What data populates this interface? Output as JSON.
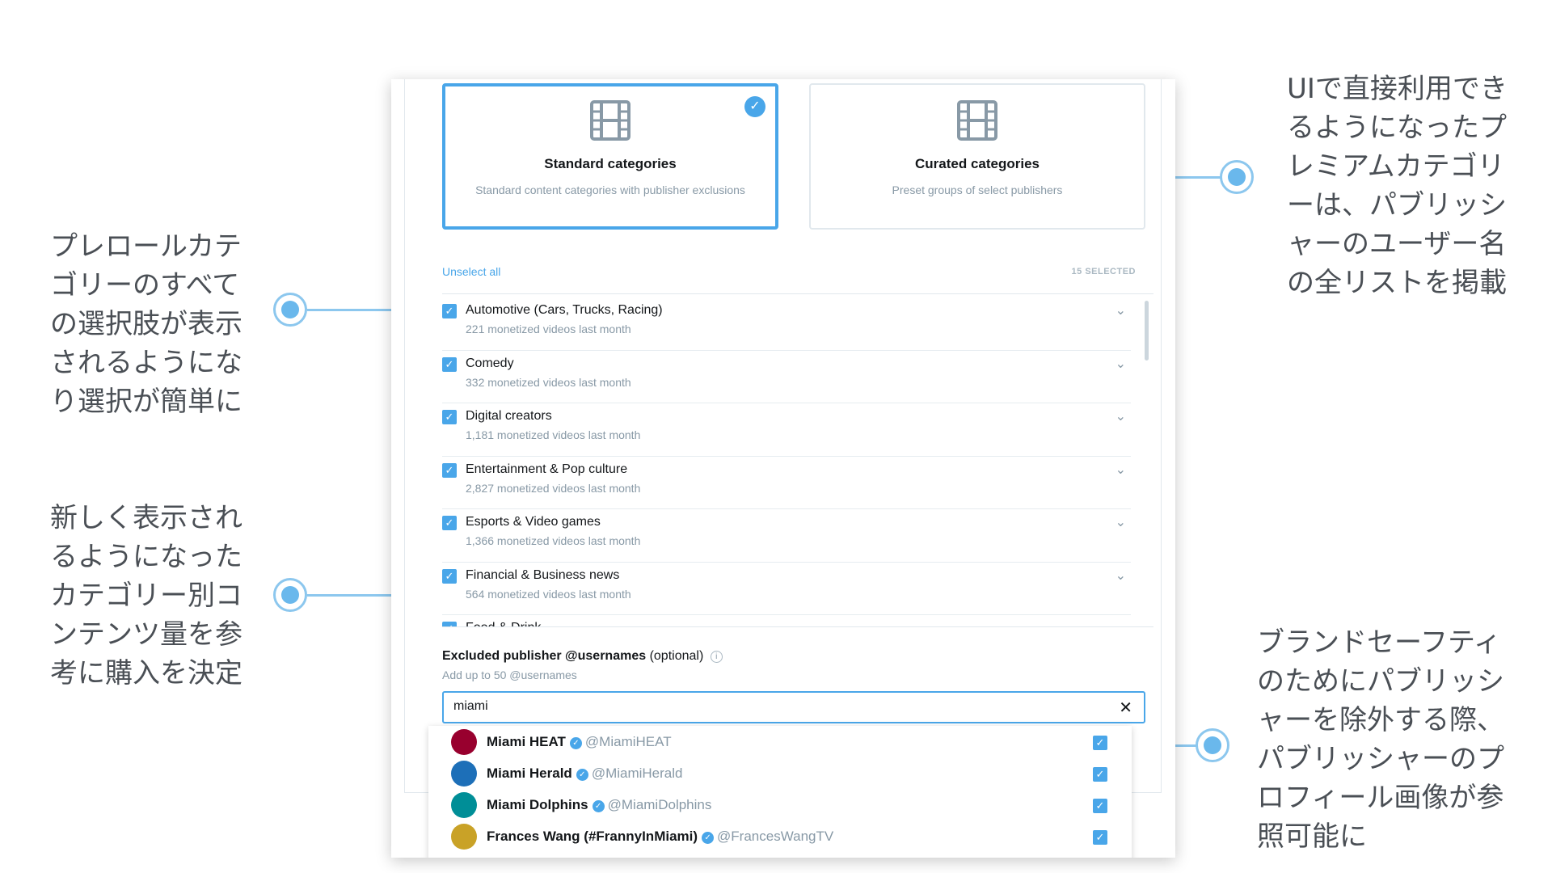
{
  "annotations": {
    "categories_note": "プレロールカテゴリーのすべての選択肢が表示されるようになり選択が簡単に",
    "volume_note": "新しく表示されるようになったカテゴリー別コンテンツ量を参考に購入を決定",
    "premium_note": "UIで直接利用できるようになったプレミアムカテゴリーは、パブリッシャーのユーザー名の全リストを掲載",
    "brand_safety_note": "ブランドセーフティのためにパブリッシャーを除外する際、パブリッシャーのプロフィール画像が参照可能に"
  },
  "category_types": [
    {
      "title": "Standard categories",
      "description": "Standard content categories with publisher exclusions",
      "selected": true,
      "icon": "film-icon"
    },
    {
      "title": "Curated categories",
      "description": "Preset groups of select publishers",
      "selected": false,
      "icon": "film-icon"
    }
  ],
  "toolbar": {
    "unselect_all": "Unselect all",
    "selected_count": "15 SELECTED"
  },
  "categories": [
    {
      "name": "Automotive (Cars, Trucks, Racing)",
      "count": "221 monetized videos last month",
      "checked": true
    },
    {
      "name": "Comedy",
      "count": "332 monetized videos last month",
      "checked": true
    },
    {
      "name": "Digital creators",
      "count": "1,181 monetized videos last month",
      "checked": true
    },
    {
      "name": "Entertainment & Pop culture",
      "count": "2,827 monetized videos last month",
      "checked": true
    },
    {
      "name": "Esports & Video games",
      "count": "1,366 monetized videos last month",
      "checked": true
    },
    {
      "name": "Financial & Business news",
      "count": "564 monetized videos last month",
      "checked": true
    },
    {
      "name": "Food & Drink",
      "count": "",
      "checked": true
    }
  ],
  "excluded": {
    "title": "Excluded publisher @usernames",
    "optional": "(optional)",
    "help_prefix": "Add up to",
    "limit": "50",
    "help_suffix": "@usernames",
    "search_value": "miami"
  },
  "results": [
    {
      "name": "Miami HEAT",
      "handle": "@MiamiHEAT",
      "verified": true,
      "checked": true,
      "avatar_color": "#98002e"
    },
    {
      "name": "Miami Herald",
      "handle": "@MiamiHerald",
      "verified": true,
      "checked": true,
      "avatar_color": "#1d6fb8"
    },
    {
      "name": "Miami Dolphins",
      "handle": "@MiamiDolphins",
      "verified": true,
      "checked": true,
      "avatar_color": "#008e97"
    },
    {
      "name": "Frances Wang (#FrannyInMiami)",
      "handle": "@FrancesWangTV",
      "verified": true,
      "checked": true,
      "avatar_color": "#c9a227"
    }
  ],
  "colors": {
    "accent": "#49a6e9",
    "connector": "#8cc7ee",
    "annotation_text": "#4a4f55"
  }
}
